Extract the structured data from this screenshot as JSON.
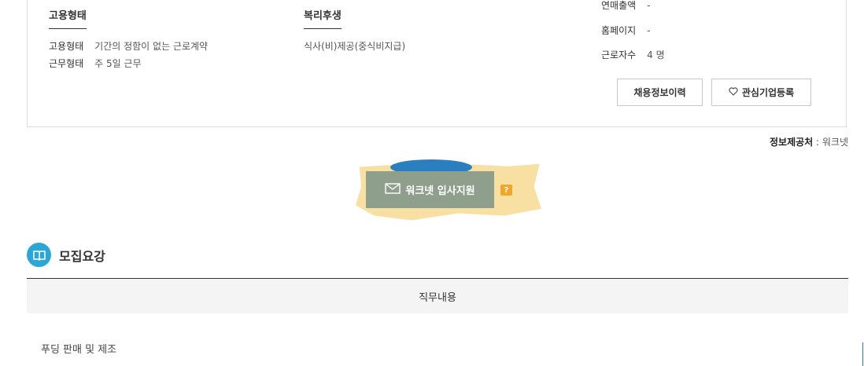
{
  "employment": {
    "title": "고용형태",
    "rows": [
      {
        "key": "고용형태",
        "value": "기간의 정함이 없는 근로계약"
      },
      {
        "key": "근무형태",
        "value": "주 5일 근무"
      }
    ]
  },
  "welfare": {
    "title": "복리후생",
    "text": "식사(비)제공(중식비지급)"
  },
  "company": {
    "rows": [
      {
        "key": "연매출액",
        "value": "-"
      },
      {
        "key": "홈페이지",
        "value": "-"
      },
      {
        "key": "근로자수",
        "value": "4 명"
      }
    ]
  },
  "buttons": {
    "history": "채용정보이력",
    "favorite": "관심기업등록"
  },
  "provider": {
    "label": "정보제공처",
    "separator": " : ",
    "value": "워크넷"
  },
  "apply": {
    "label": "워크넷 입사지원",
    "help": "?"
  },
  "recruit": {
    "title": "모집요강",
    "table_header": "직무내용",
    "job_description": "푸딩 판매 및 제조"
  },
  "colors": {
    "accent": "#2aa7d6",
    "apply_bg": "#8e9f8b",
    "highlight": "#f7dc98",
    "help_badge": "#f2a627"
  },
  "icons": {
    "favorite": "heart-outline-icon",
    "apply": "envelope-icon",
    "section": "book-icon"
  }
}
